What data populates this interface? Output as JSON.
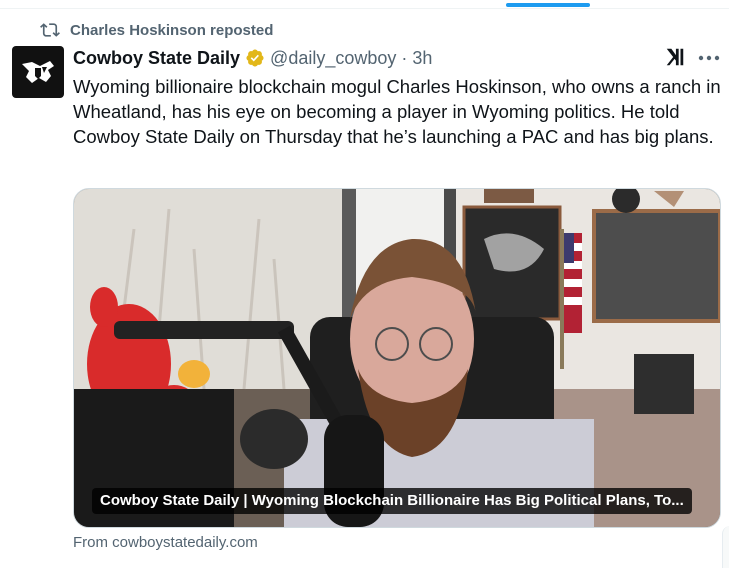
{
  "repost": {
    "icon": "repost-icon",
    "text": "Charles Hoskinson reposted"
  },
  "tweet": {
    "author_name": "Cowboy State Daily",
    "verified_badge": "gold-verified-icon",
    "handle": "@daily_cowboy",
    "separator": "·",
    "time": "3h",
    "text": "Wyoming billionaire blockchain mogul Charles Hoskinson, who owns a ranch in Wheatland, has his eye on becoming a player in Wyoming politics. He told Cowboy State Daily on Thursday that he’s launching a PAC and has big plans.",
    "media_caption": "Cowboy State Daily | Wyoming Blockchain Billionaire Has Big Political Plans, To...",
    "source": "From cowboystatedaily.com"
  },
  "colors": {
    "accent": "#1d9bf0",
    "secondary_text": "#536471",
    "verified_gold": "#e2b719"
  }
}
